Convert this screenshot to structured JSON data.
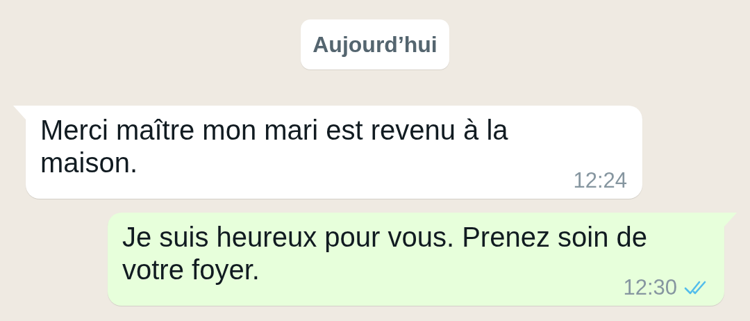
{
  "date_chip": "Aujourd’hui",
  "messages": [
    {
      "kind": "incoming",
      "text": "Merci maître mon mari est revenu à la maison.",
      "time": "12:24"
    },
    {
      "kind": "outgoing",
      "text": "Je suis heureux pour vous. Prenez soin de votre foyer.",
      "time": "12:30",
      "read": true
    }
  ]
}
